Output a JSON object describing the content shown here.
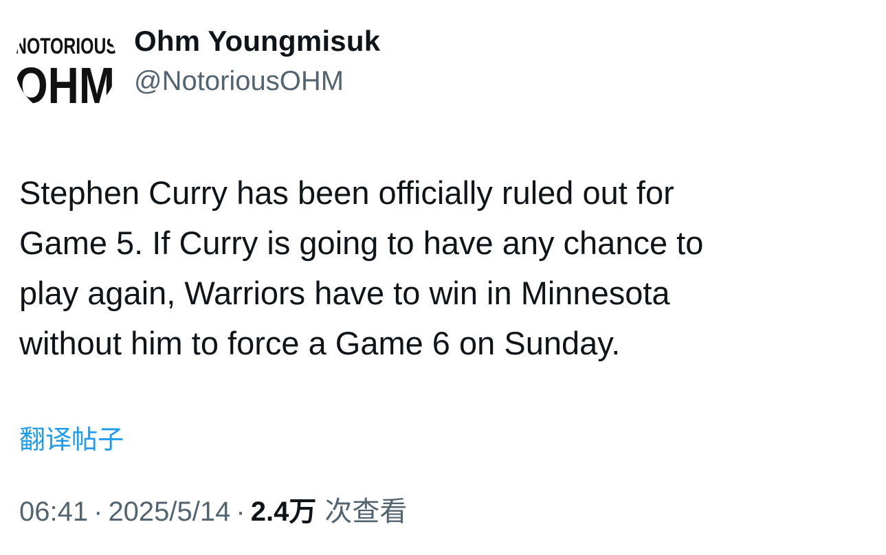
{
  "author": {
    "display_name": "Ohm Youngmisuk",
    "handle": "@NotoriousOHM",
    "avatar_text_top": "NOTORIOUS",
    "avatar_text_bottom": "OHM"
  },
  "tweet": {
    "lines": [
      "Stephen Curry has been officially ruled out for",
      "Game 5. If Curry is going to have any chance to",
      "play again, Warriors have to win in Minnesota",
      "without him to force a Game 6 on Sunday."
    ],
    "translate_label": "翻译帖子"
  },
  "meta": {
    "time": "06:41",
    "separator": "·",
    "date": "2025/5/14",
    "views_count": "2.4万",
    "views_label": "次查看"
  },
  "colors": {
    "text_primary": "#0f1419",
    "text_secondary": "#536471",
    "link": "#1d9bf0"
  }
}
